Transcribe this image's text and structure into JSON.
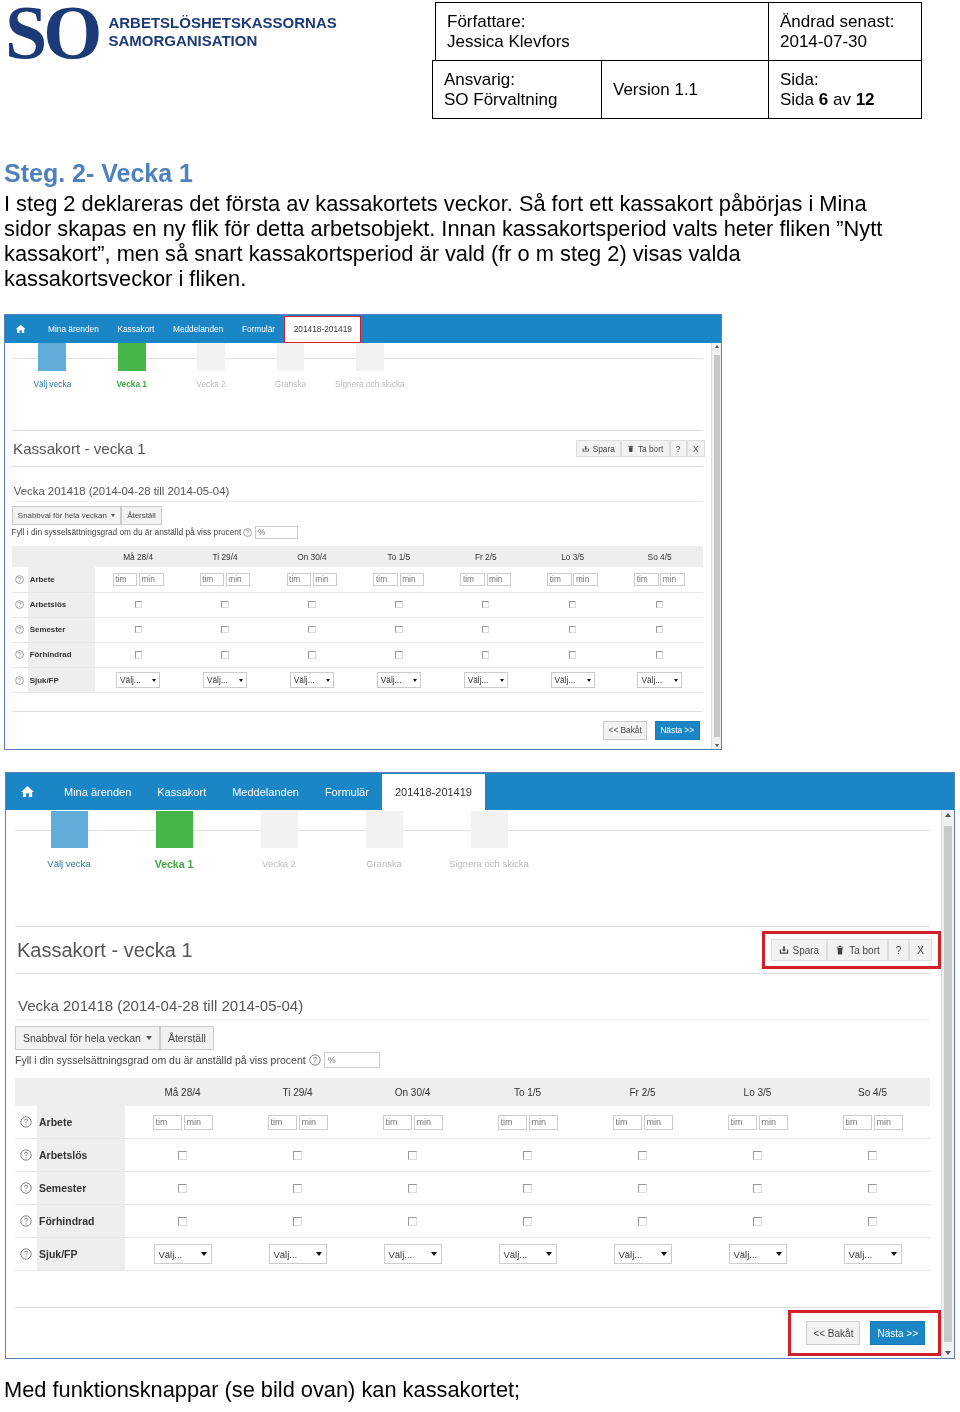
{
  "header": {
    "logo": {
      "mark": "SO",
      "lines": [
        "ARBETSLÖSHETSKASSORNAS",
        "SAMORGANISATION"
      ]
    },
    "author": {
      "label": "Författare:",
      "value": "Jessica Klevfors"
    },
    "changed": {
      "label": "Ändrad senast:",
      "value": "2014-07-30"
    },
    "responsible": {
      "label": "Ansvarig:",
      "value": "SO Förvaltning"
    },
    "version": "Version 1.1",
    "page": {
      "label": "Sida:",
      "value": "Sida **6** av **12**"
    }
  },
  "heading": "Steg. 2- Vecka 1",
  "paragraph": "I steg 2 deklareras det första av kassakortets veckor. Så fort ett kassakort påbörjas i Mina sidor skapas en ny flik för detta arbetsobjekt. Innan kassakortsperiod valts heter fliken ”Nytt kassakort”, men så snart kassakortsperiod är vald (fr o m steg 2) visas valda kassakortsveckor i fliken.",
  "screenshots": [
    {
      "tabs": [
        {
          "label": "Mina ärenden",
          "selected": false,
          "highlighted": false
        },
        {
          "label": "Kassakort",
          "selected": false,
          "highlighted": false
        },
        {
          "label": "Meddelanden",
          "selected": false,
          "highlighted": false
        },
        {
          "label": "Formulär",
          "selected": false,
          "highlighted": false
        },
        {
          "label": "201418-201419",
          "selected": true,
          "highlighted": true
        }
      ],
      "steps": [
        {
          "label": "Välj vecka",
          "completed": true,
          "current": false
        },
        {
          "label": "Vecka 1",
          "completed": false,
          "current": true
        },
        {
          "label": "Vecka 2",
          "completed": false,
          "current": false
        },
        {
          "label": "Granska",
          "completed": false,
          "current": false
        },
        {
          "label": "Signera och skicka",
          "completed": false,
          "current": false
        }
      ],
      "title": "Kassakort - vecka 1",
      "toolbar": {
        "highlighted": false,
        "buttons": [
          {
            "kind": "save",
            "label": "Spara"
          },
          {
            "kind": "delete",
            "label": "Ta bort"
          },
          {
            "kind": "plain",
            "label": "?"
          },
          {
            "kind": "plain",
            "label": "X"
          }
        ]
      },
      "week_title": "Vecka 201418 (2014-04-28 till 2014-05-04)",
      "quick_choice": "Snabbval för hela veckan",
      "reset": "Återställ",
      "percent": {
        "label": "Fyll i din sysselsättningsgrad om du är anställd på viss procent",
        "placeholder": "%"
      },
      "days": [
        "Må 28/4",
        "Ti 29/4",
        "On 30/4",
        "To 1/5",
        "Fr 2/5",
        "Lo 3/5",
        "So 4/5"
      ],
      "rows": [
        {
          "label": "Arbete",
          "kind": "time",
          "cells": [
            {
              "fields": [
                {
                  "placeholder": "tim"
                },
                {
                  "placeholder": "min"
                }
              ]
            },
            {
              "fields": [
                {
                  "placeholder": "tim"
                },
                {
                  "placeholder": "min"
                }
              ]
            },
            {
              "fields": [
                {
                  "placeholder": "tim"
                },
                {
                  "placeholder": "min"
                }
              ]
            },
            {
              "fields": [
                {
                  "placeholder": "tim"
                },
                {
                  "placeholder": "min"
                }
              ]
            },
            {
              "fields": [
                {
                  "placeholder": "tim"
                },
                {
                  "placeholder": "min"
                }
              ]
            },
            {
              "fields": [
                {
                  "placeholder": "tim"
                },
                {
                  "placeholder": "min"
                }
              ]
            },
            {
              "fields": [
                {
                  "placeholder": "tim"
                },
                {
                  "placeholder": "min"
                }
              ]
            }
          ]
        },
        {
          "label": "Arbetslös",
          "kind": "checkbox",
          "cells": [
            {
              "checked": false
            },
            {
              "checked": false
            },
            {
              "checked": false
            },
            {
              "checked": false
            },
            {
              "checked": false
            },
            {
              "checked": false
            },
            {
              "checked": false
            }
          ]
        },
        {
          "label": "Semester",
          "kind": "checkbox",
          "cells": [
            {
              "checked": false
            },
            {
              "checked": false
            },
            {
              "checked": false
            },
            {
              "checked": false
            },
            {
              "checked": false
            },
            {
              "checked": false
            },
            {
              "checked": false
            }
          ]
        },
        {
          "label": "Förhindrad",
          "kind": "checkbox",
          "cells": [
            {
              "checked": false
            },
            {
              "checked": false
            },
            {
              "checked": false
            },
            {
              "checked": false
            },
            {
              "checked": false
            },
            {
              "checked": false
            },
            {
              "checked": false
            }
          ]
        },
        {
          "label": "Sjuk/FP",
          "kind": "select",
          "cells": [
            {
              "value": "Välj..."
            },
            {
              "value": "Välj..."
            },
            {
              "value": "Välj..."
            },
            {
              "value": "Välj..."
            },
            {
              "value": "Välj..."
            },
            {
              "value": "Välj..."
            },
            {
              "value": "Välj..."
            }
          ]
        }
      ],
      "nav": {
        "highlighted": false,
        "back": "<< Bakåt",
        "next": "Nästa >>"
      }
    },
    {
      "tabs": [
        {
          "label": "Mina ärenden",
          "selected": false,
          "highlighted": false
        },
        {
          "label": "Kassakort",
          "selected": false,
          "highlighted": false
        },
        {
          "label": "Meddelanden",
          "selected": false,
          "highlighted": false
        },
        {
          "label": "Formulär",
          "selected": false,
          "highlighted": false
        },
        {
          "label": "201418-201419",
          "selected": true,
          "highlighted": false
        }
      ],
      "steps": [
        {
          "label": "Välj vecka",
          "completed": true,
          "current": false
        },
        {
          "label": "Vecka 1",
          "completed": false,
          "current": true
        },
        {
          "label": "Vecka 2",
          "completed": false,
          "current": false
        },
        {
          "label": "Granska",
          "completed": false,
          "current": false
        },
        {
          "label": "Signera och skicka",
          "completed": false,
          "current": false
        }
      ],
      "title": "Kassakort - vecka 1",
      "toolbar": {
        "highlighted": true,
        "buttons": [
          {
            "kind": "save",
            "label": "Spara"
          },
          {
            "kind": "delete",
            "label": "Ta bort"
          },
          {
            "kind": "plain",
            "label": "?"
          },
          {
            "kind": "plain",
            "label": "X"
          }
        ]
      },
      "week_title": "Vecka 201418 (2014-04-28 till 2014-05-04)",
      "quick_choice": "Snabbval för hela veckan",
      "reset": "Återställ",
      "percent": {
        "label": "Fyll i din sysselsättningsgrad om du är anställd på viss procent",
        "placeholder": "%"
      },
      "days": [
        "Må 28/4",
        "Ti 29/4",
        "On 30/4",
        "To 1/5",
        "Fr 2/5",
        "Lo 3/5",
        "So 4/5"
      ],
      "rows": [
        {
          "label": "Arbete",
          "kind": "time",
          "cells": [
            {
              "fields": [
                {
                  "placeholder": "tim"
                },
                {
                  "placeholder": "min"
                }
              ]
            },
            {
              "fields": [
                {
                  "placeholder": "tim"
                },
                {
                  "placeholder": "min"
                }
              ]
            },
            {
              "fields": [
                {
                  "placeholder": "tim"
                },
                {
                  "placeholder": "min"
                }
              ]
            },
            {
              "fields": [
                {
                  "placeholder": "tim"
                },
                {
                  "placeholder": "min"
                }
              ]
            },
            {
              "fields": [
                {
                  "placeholder": "tim"
                },
                {
                  "placeholder": "min"
                }
              ]
            },
            {
              "fields": [
                {
                  "placeholder": "tim"
                },
                {
                  "placeholder": "min"
                }
              ]
            },
            {
              "fields": [
                {
                  "placeholder": "tim"
                },
                {
                  "placeholder": "min"
                }
              ]
            }
          ]
        },
        {
          "label": "Arbetslös",
          "kind": "checkbox",
          "cells": [
            {
              "checked": false
            },
            {
              "checked": false
            },
            {
              "checked": false
            },
            {
              "checked": false
            },
            {
              "checked": false
            },
            {
              "checked": false
            },
            {
              "checked": false
            }
          ]
        },
        {
          "label": "Semester",
          "kind": "checkbox",
          "cells": [
            {
              "checked": false
            },
            {
              "checked": false
            },
            {
              "checked": false
            },
            {
              "checked": false
            },
            {
              "checked": false
            },
            {
              "checked": false
            },
            {
              "checked": false
            }
          ]
        },
        {
          "label": "Förhindrad",
          "kind": "checkbox",
          "cells": [
            {
              "checked": false
            },
            {
              "checked": false
            },
            {
              "checked": false
            },
            {
              "checked": false
            },
            {
              "checked": false
            },
            {
              "checked": false
            },
            {
              "checked": false
            }
          ]
        },
        {
          "label": "Sjuk/FP",
          "kind": "select",
          "cells": [
            {
              "value": "Välj..."
            },
            {
              "value": "Välj..."
            },
            {
              "value": "Välj..."
            },
            {
              "value": "Välj..."
            },
            {
              "value": "Välj..."
            },
            {
              "value": "Välj..."
            },
            {
              "value": "Välj..."
            }
          ]
        }
      ],
      "nav": {
        "highlighted": true,
        "back": "<< Bakåt",
        "next": "Nästa >>"
      }
    }
  ],
  "footer_text": "Med funktionsknappar (se bild ovan) kan kassakortet;"
}
